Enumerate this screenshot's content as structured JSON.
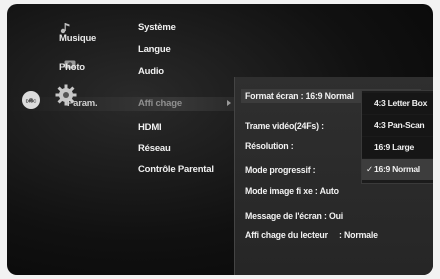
{
  "main_menu": {
    "items": [
      {
        "label": "Musique"
      },
      {
        "label": "Photo"
      },
      {
        "label": "Param."
      }
    ],
    "disc_label": "DISC"
  },
  "setup_categories": {
    "items": [
      {
        "label": "Système"
      },
      {
        "label": "Langue"
      },
      {
        "label": "Audio"
      },
      {
        "label": "Affi chage"
      },
      {
        "label": "HDMI"
      },
      {
        "label": "Réseau"
      },
      {
        "label": "Contrôle Parental"
      }
    ]
  },
  "settings": {
    "format": {
      "label": "Format écran",
      "sep": " : ",
      "value": "16:9 Normal"
    },
    "rows": [
      {
        "label": "Trame vidéo(24Fs)",
        "sep": " : ",
        "value": ""
      },
      {
        "label": "Résolution",
        "sep": " : ",
        "value": ""
      },
      {
        "label": "Mode progressif",
        "sep": " : ",
        "value": ""
      },
      {
        "label": "Mode image fi xe",
        "sep": " : ",
        "value": "Auto"
      },
      {
        "label": "Message de l'écran",
        "sep": " : ",
        "value": "Oui"
      },
      {
        "label": "Affi chage du lecteur",
        "sep": "     : ",
        "value": "Normale"
      }
    ]
  },
  "dropdown": {
    "options": [
      {
        "label": "4:3 Letter Box"
      },
      {
        "label": "4:3 Pan-Scan"
      },
      {
        "label": "16:9 Large"
      },
      {
        "label": "16:9 Normal",
        "selected": true
      }
    ],
    "check_mark": "✓"
  },
  "colors": {
    "background": "#111111",
    "text": "#f0f0f0",
    "dim_text": "#8f8f8f",
    "highlight": "#3d3d3d"
  }
}
